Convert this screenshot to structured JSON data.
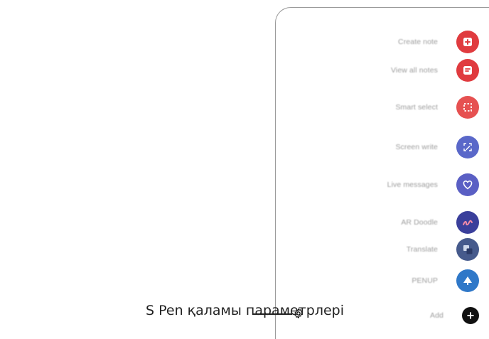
{
  "panel": {
    "items": [
      {
        "label": "Create note",
        "icon": "create-note-icon",
        "color": "#e03b3f"
      },
      {
        "label": "View all notes",
        "icon": "view-notes-icon",
        "color": "#e03b3f"
      },
      {
        "label": "Smart select",
        "icon": "smart-select-icon",
        "color": "#e65151"
      },
      {
        "label": "Screen write",
        "icon": "screen-write-icon",
        "color": "#5a68c9"
      },
      {
        "label": "Live messages",
        "icon": "live-messages-icon",
        "color": "#5a5fc4"
      },
      {
        "label": "AR Doodle",
        "icon": "ar-doodle-icon",
        "color": "#3a3f9b"
      },
      {
        "label": "Translate",
        "icon": "translate-icon",
        "color": "#465a8c"
      },
      {
        "label": "PENUP",
        "icon": "penup-icon",
        "color": "#2f78c8"
      },
      {
        "label": "Add",
        "icon": "add-icon",
        "color": "#111111"
      }
    ]
  },
  "callout": {
    "text": "S Pen қаламы параметрлері"
  },
  "settings": {
    "icon": "gear-icon"
  }
}
